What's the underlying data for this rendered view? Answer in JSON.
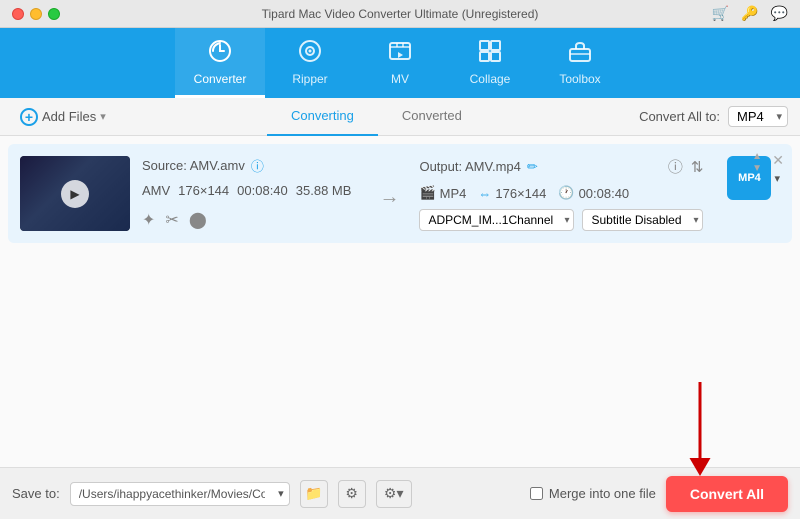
{
  "titleBar": {
    "title": "Tipard Mac Video Converter Ultimate (Unregistered)"
  },
  "nav": {
    "items": [
      {
        "id": "converter",
        "label": "Converter",
        "icon": "⟳",
        "active": true
      },
      {
        "id": "ripper",
        "label": "Ripper",
        "icon": "◎"
      },
      {
        "id": "mv",
        "label": "MV",
        "icon": "🖼"
      },
      {
        "id": "collage",
        "label": "Collage",
        "icon": "⊞"
      },
      {
        "id": "toolbox",
        "label": "Toolbox",
        "icon": "🧰"
      }
    ]
  },
  "toolbar": {
    "addFilesLabel": "Add Files",
    "tabs": [
      {
        "id": "converting",
        "label": "Converting",
        "active": true
      },
      {
        "id": "converted",
        "label": "Converted"
      }
    ],
    "convertAllToLabel": "Convert All to:",
    "selectedFormat": "MP4"
  },
  "fileRow": {
    "sourceLabel": "Source: AMV.amv",
    "format": "AMV",
    "resolution": "176×144",
    "duration": "00:08:40",
    "fileSize": "35.88 MB",
    "outputLabel": "Output: AMV.mp4",
    "outputFormat": "MP4",
    "outputResolution": "176×144",
    "outputDuration": "00:08:40",
    "audioSelect": "ADPCM_IM...1Channel",
    "subtitleSelect": "Subtitle Disabled",
    "formatBadge": "MP4"
  },
  "bottomBar": {
    "saveToLabel": "Save to:",
    "savePath": "/Users/ihappyacethinker/Movies/Converted",
    "mergeLabel": "Merge into one file",
    "convertAllLabel": "Convert All"
  },
  "icons": {
    "close": "✕",
    "minimize": "−",
    "maximize": "+",
    "cart": "🛒",
    "key": "🔑",
    "chat": "💬",
    "chevronDown": "▾",
    "chevronUp": "▴",
    "arrowRight": "→",
    "info": "ⓘ",
    "edit": "✏",
    "settings1": "ⓘ",
    "settings2": "⇅",
    "sparkle": "✦",
    "scissors": "✂",
    "palette": "⬤",
    "folder": "📁",
    "gear": "⚙",
    "gear2": "⚙"
  }
}
